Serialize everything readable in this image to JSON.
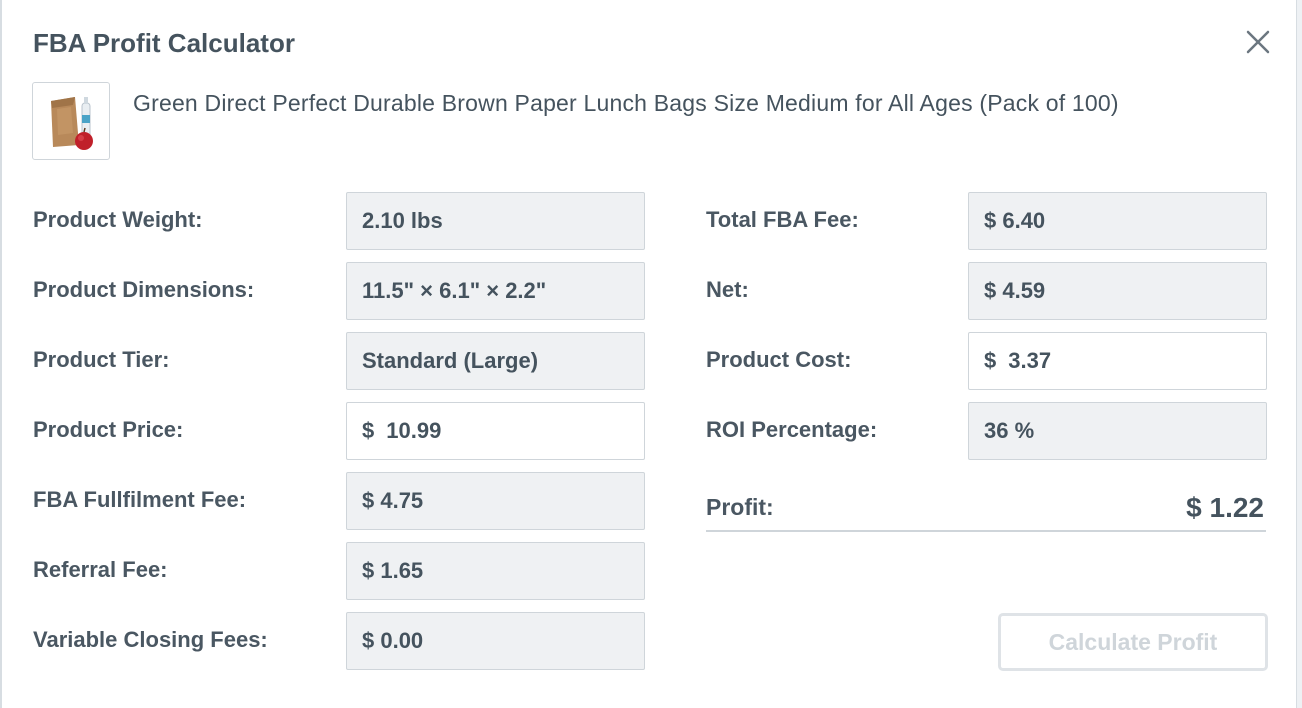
{
  "dialog": {
    "title": "FBA Profit Calculator",
    "close_icon": "close-icon"
  },
  "product": {
    "name": "Green Direct Perfect Durable Brown Paper Lunch Bags Size Medium for All Ages (Pack of 100)",
    "thumbnail_icon": "paper-bag-apple-thumbnail"
  },
  "left_fields": [
    {
      "label": "Product Weight:",
      "value": "2.10 lbs"
    },
    {
      "label": "Product Dimensions:",
      "value": "11.5\" × 6.1\" × 2.2\""
    },
    {
      "label": "Product Tier:",
      "value": "Standard (Large)"
    },
    {
      "label": "Product Price:",
      "currency": "$",
      "value": "10.99"
    },
    {
      "label": "FBA Fullfilment Fee:",
      "value": "$ 4.75"
    },
    {
      "label": "Referral Fee:",
      "value": "$ 1.65"
    },
    {
      "label": "Variable Closing Fees:",
      "value": "$ 0.00"
    }
  ],
  "right_fields": [
    {
      "label": "Total FBA Fee:",
      "value": "$ 6.40"
    },
    {
      "label": "Net:",
      "value": "$ 4.59"
    },
    {
      "label": "Product Cost:",
      "currency": "$",
      "value": "3.37"
    },
    {
      "label": "ROI Percentage:",
      "value": "36 %"
    }
  ],
  "profit": {
    "label": "Profit:",
    "value": "$ 1.22"
  },
  "calculate_button": {
    "label": "Calculate Profit"
  },
  "colors": {
    "text": "#45535e",
    "readonly_bg": "#eff1f3",
    "border": "#cfd5da",
    "disabled_text": "#cfd5da"
  }
}
